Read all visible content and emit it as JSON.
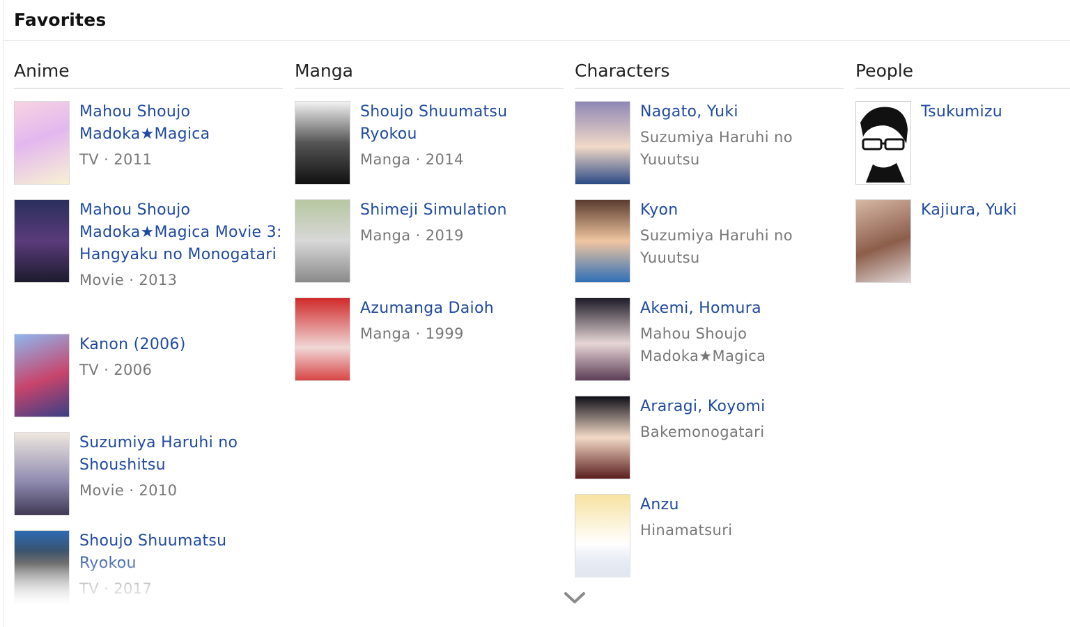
{
  "section": {
    "title": "Favorites"
  },
  "columns": {
    "anime": {
      "header": "Anime",
      "items": [
        {
          "title": "Mahou Shoujo Madoka★Magica",
          "meta": "TV · 2011"
        },
        {
          "title": "Mahou Shoujo Madoka★Magica Movie 3: Hangyaku no Monogatari",
          "meta": "Movie · 2013"
        },
        {
          "title": "Kanon (2006)",
          "meta": "TV · 2006"
        },
        {
          "title": "Suzumiya Haruhi no Shoushitsu",
          "meta": "Movie · 2010"
        },
        {
          "title": "Shoujo Shuumatsu Ryokou",
          "meta": "TV · 2017"
        }
      ]
    },
    "manga": {
      "header": "Manga",
      "items": [
        {
          "title": "Shoujo Shuumatsu Ryokou",
          "meta": "Manga · 2014"
        },
        {
          "title": "Shimeji Simulation",
          "meta": "Manga · 2019"
        },
        {
          "title": "Azumanga Daioh",
          "meta": "Manga · 1999"
        }
      ]
    },
    "characters": {
      "header": "Characters",
      "items": [
        {
          "title": "Nagato, Yuki",
          "meta": "Suzumiya Haruhi no Yuuutsu"
        },
        {
          "title": "Kyon",
          "meta": "Suzumiya Haruhi no Yuuutsu"
        },
        {
          "title": "Akemi, Homura",
          "meta": "Mahou Shoujo Madoka★Magica"
        },
        {
          "title": "Araragi, Koyomi",
          "meta": "Bakemonogatari"
        },
        {
          "title": "Anzu",
          "meta": "Hinamatsuri"
        }
      ]
    },
    "people": {
      "header": "People",
      "items": [
        {
          "title": "Tsukumizu"
        },
        {
          "title": "Kajiura, Yuki"
        }
      ]
    }
  },
  "expand": {
    "icon": "chevron-down-icon"
  },
  "colors": {
    "link": "#1f4aa0",
    "meta": "#777777",
    "divider": "#e5e5e5"
  }
}
